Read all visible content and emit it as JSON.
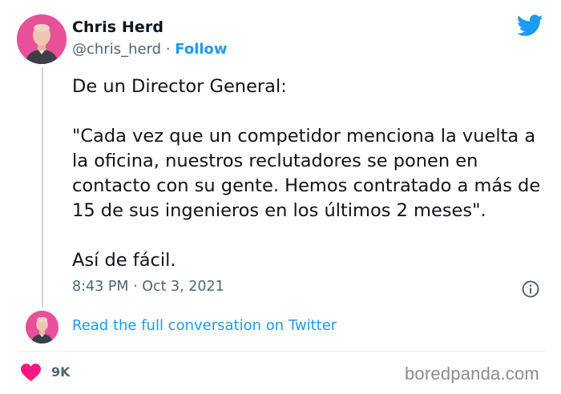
{
  "author": {
    "name": "Chris Herd",
    "handle": "@chris_herd",
    "separator": "·",
    "follow_label": "Follow"
  },
  "tweet": {
    "text": "De un Director General:\n\n\"Cada vez que un competidor menciona la vuelta a la oficina, nuestros reclutadores se ponen en contacto con su gente. Hemos contratado a más de 15 de sus ingenieros en los últimos 2 meses\".\n\nAsí de fácil.",
    "timestamp": "8:43 PM · Oct 3, 2021"
  },
  "conversation": {
    "link_label": "Read the full conversation on Twitter"
  },
  "engagement": {
    "likes": "9K"
  },
  "watermark": "boredpanda.com",
  "icons": {
    "brand": "twitter-bird-icon",
    "info": "info-icon",
    "like": "heart-icon"
  },
  "colors": {
    "accent": "#1d9bf0",
    "heart": "#f91880",
    "avatar_bg": "#e8509a",
    "secondary_text": "#536471"
  }
}
